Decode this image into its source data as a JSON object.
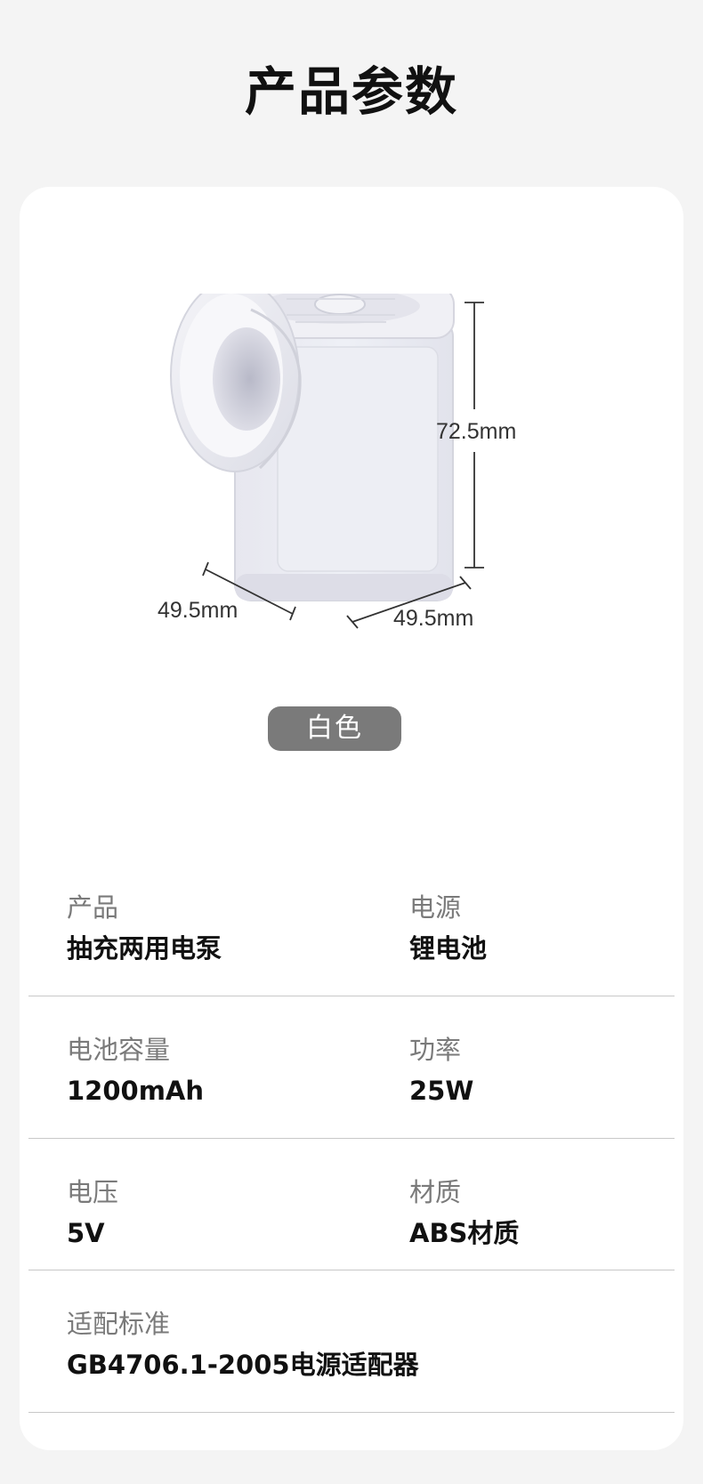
{
  "page": {
    "title": "产品参数"
  },
  "figure": {
    "height_label": "72.5mm",
    "depth_label": "49.5mm",
    "width_label": "49.5mm"
  },
  "color_badge": "白色",
  "specs": [
    {
      "left": {
        "label": "产品",
        "value": "抽充两用电泵"
      },
      "right": {
        "label": "电源",
        "value": "锂电池"
      }
    },
    {
      "left": {
        "label": "电池容量",
        "value": "1200mAh"
      },
      "right": {
        "label": "功率",
        "value": "25W"
      }
    },
    {
      "left": {
        "label": "电压",
        "value": "5V"
      },
      "right": {
        "label": "材质",
        "value": "ABS材质"
      }
    },
    {
      "left": {
        "label": "适配标准",
        "value": "GB4706.1-2005电源适配器"
      }
    }
  ]
}
